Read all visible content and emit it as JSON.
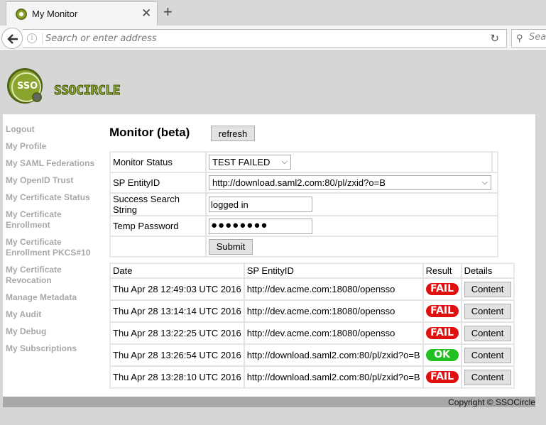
{
  "browser": {
    "tab_title": "My Monitor",
    "tab_close": "✕",
    "new_tab": "+",
    "url_placeholder": "Search or enter address",
    "search_placeholder": "Sea"
  },
  "logo": {
    "text": "SSOCIRCLE",
    "badge": "SSO"
  },
  "sidebar": {
    "items": [
      "Logout",
      "My Profile",
      "My SAML Federations",
      "My OpenID Trust",
      "My Certificate Status",
      "My Certificate Enrollment",
      "My Certificate Enrollment PKCS#10",
      "My Certificate Revocation",
      "Manage Metadata",
      "My Audit",
      "My Debug",
      "My Subscriptions"
    ]
  },
  "main": {
    "title": "Monitor (beta)",
    "refresh_label": "refresh"
  },
  "form": {
    "status_label": "Monitor Status",
    "status_value": "TEST FAILED",
    "entity_label": "SP EntityID",
    "entity_value": "http://download.saml2.com:80/pl/zxid?o=B",
    "search_label": "Success Search String",
    "search_value": "logged in",
    "password_label": "Temp Password",
    "password_value": "●●●●●●●●",
    "submit_label": "Submit"
  },
  "results": {
    "headers": [
      "Date",
      "SP EntityID",
      "Result",
      "Details"
    ],
    "rows": [
      {
        "date": "Thu Apr 28 12:49:03 UTC 2016",
        "entity": "http://dev.acme.com:18080/opensso",
        "result": "FAIL",
        "details": "Content"
      },
      {
        "date": "Thu Apr 28 13:14:14 UTC 2016",
        "entity": "http://dev.acme.com:18080/opensso",
        "result": "FAIL",
        "details": "Content"
      },
      {
        "date": "Thu Apr 28 13:22:25 UTC 2016",
        "entity": "http://dev.acme.com:18080/opensso",
        "result": "FAIL",
        "details": "Content"
      },
      {
        "date": "Thu Apr 28 13:26:54 UTC 2016",
        "entity": "http://download.saml2.com:80/pl/zxid?o=B",
        "result": "OK",
        "details": "Content"
      },
      {
        "date": "Thu Apr 28 13:28:10 UTC 2016",
        "entity": "http://download.saml2.com:80/pl/zxid?o=B",
        "result": "FAIL",
        "details": "Content"
      }
    ]
  },
  "footer": {
    "copyright": "Copyright © SSOCircle"
  }
}
